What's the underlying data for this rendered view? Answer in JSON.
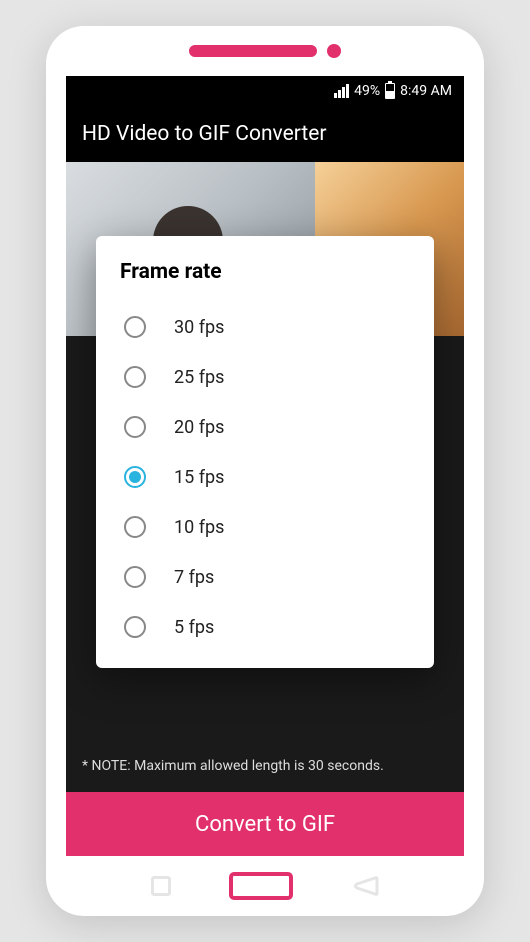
{
  "status": {
    "battery_pct": "49%",
    "time": "8:49 AM"
  },
  "app": {
    "title": "HD Video to GIF Converter",
    "note": "* NOTE: Maximum allowed length is 30 seconds.",
    "convert_label": "Convert to GIF"
  },
  "dialog": {
    "title": "Frame rate",
    "options": [
      {
        "label": "30 fps",
        "selected": false
      },
      {
        "label": "25 fps",
        "selected": false
      },
      {
        "label": "20 fps",
        "selected": false
      },
      {
        "label": "15 fps",
        "selected": true
      },
      {
        "label": "10 fps",
        "selected": false
      },
      {
        "label": "7 fps",
        "selected": false
      },
      {
        "label": "5 fps",
        "selected": false
      }
    ]
  }
}
